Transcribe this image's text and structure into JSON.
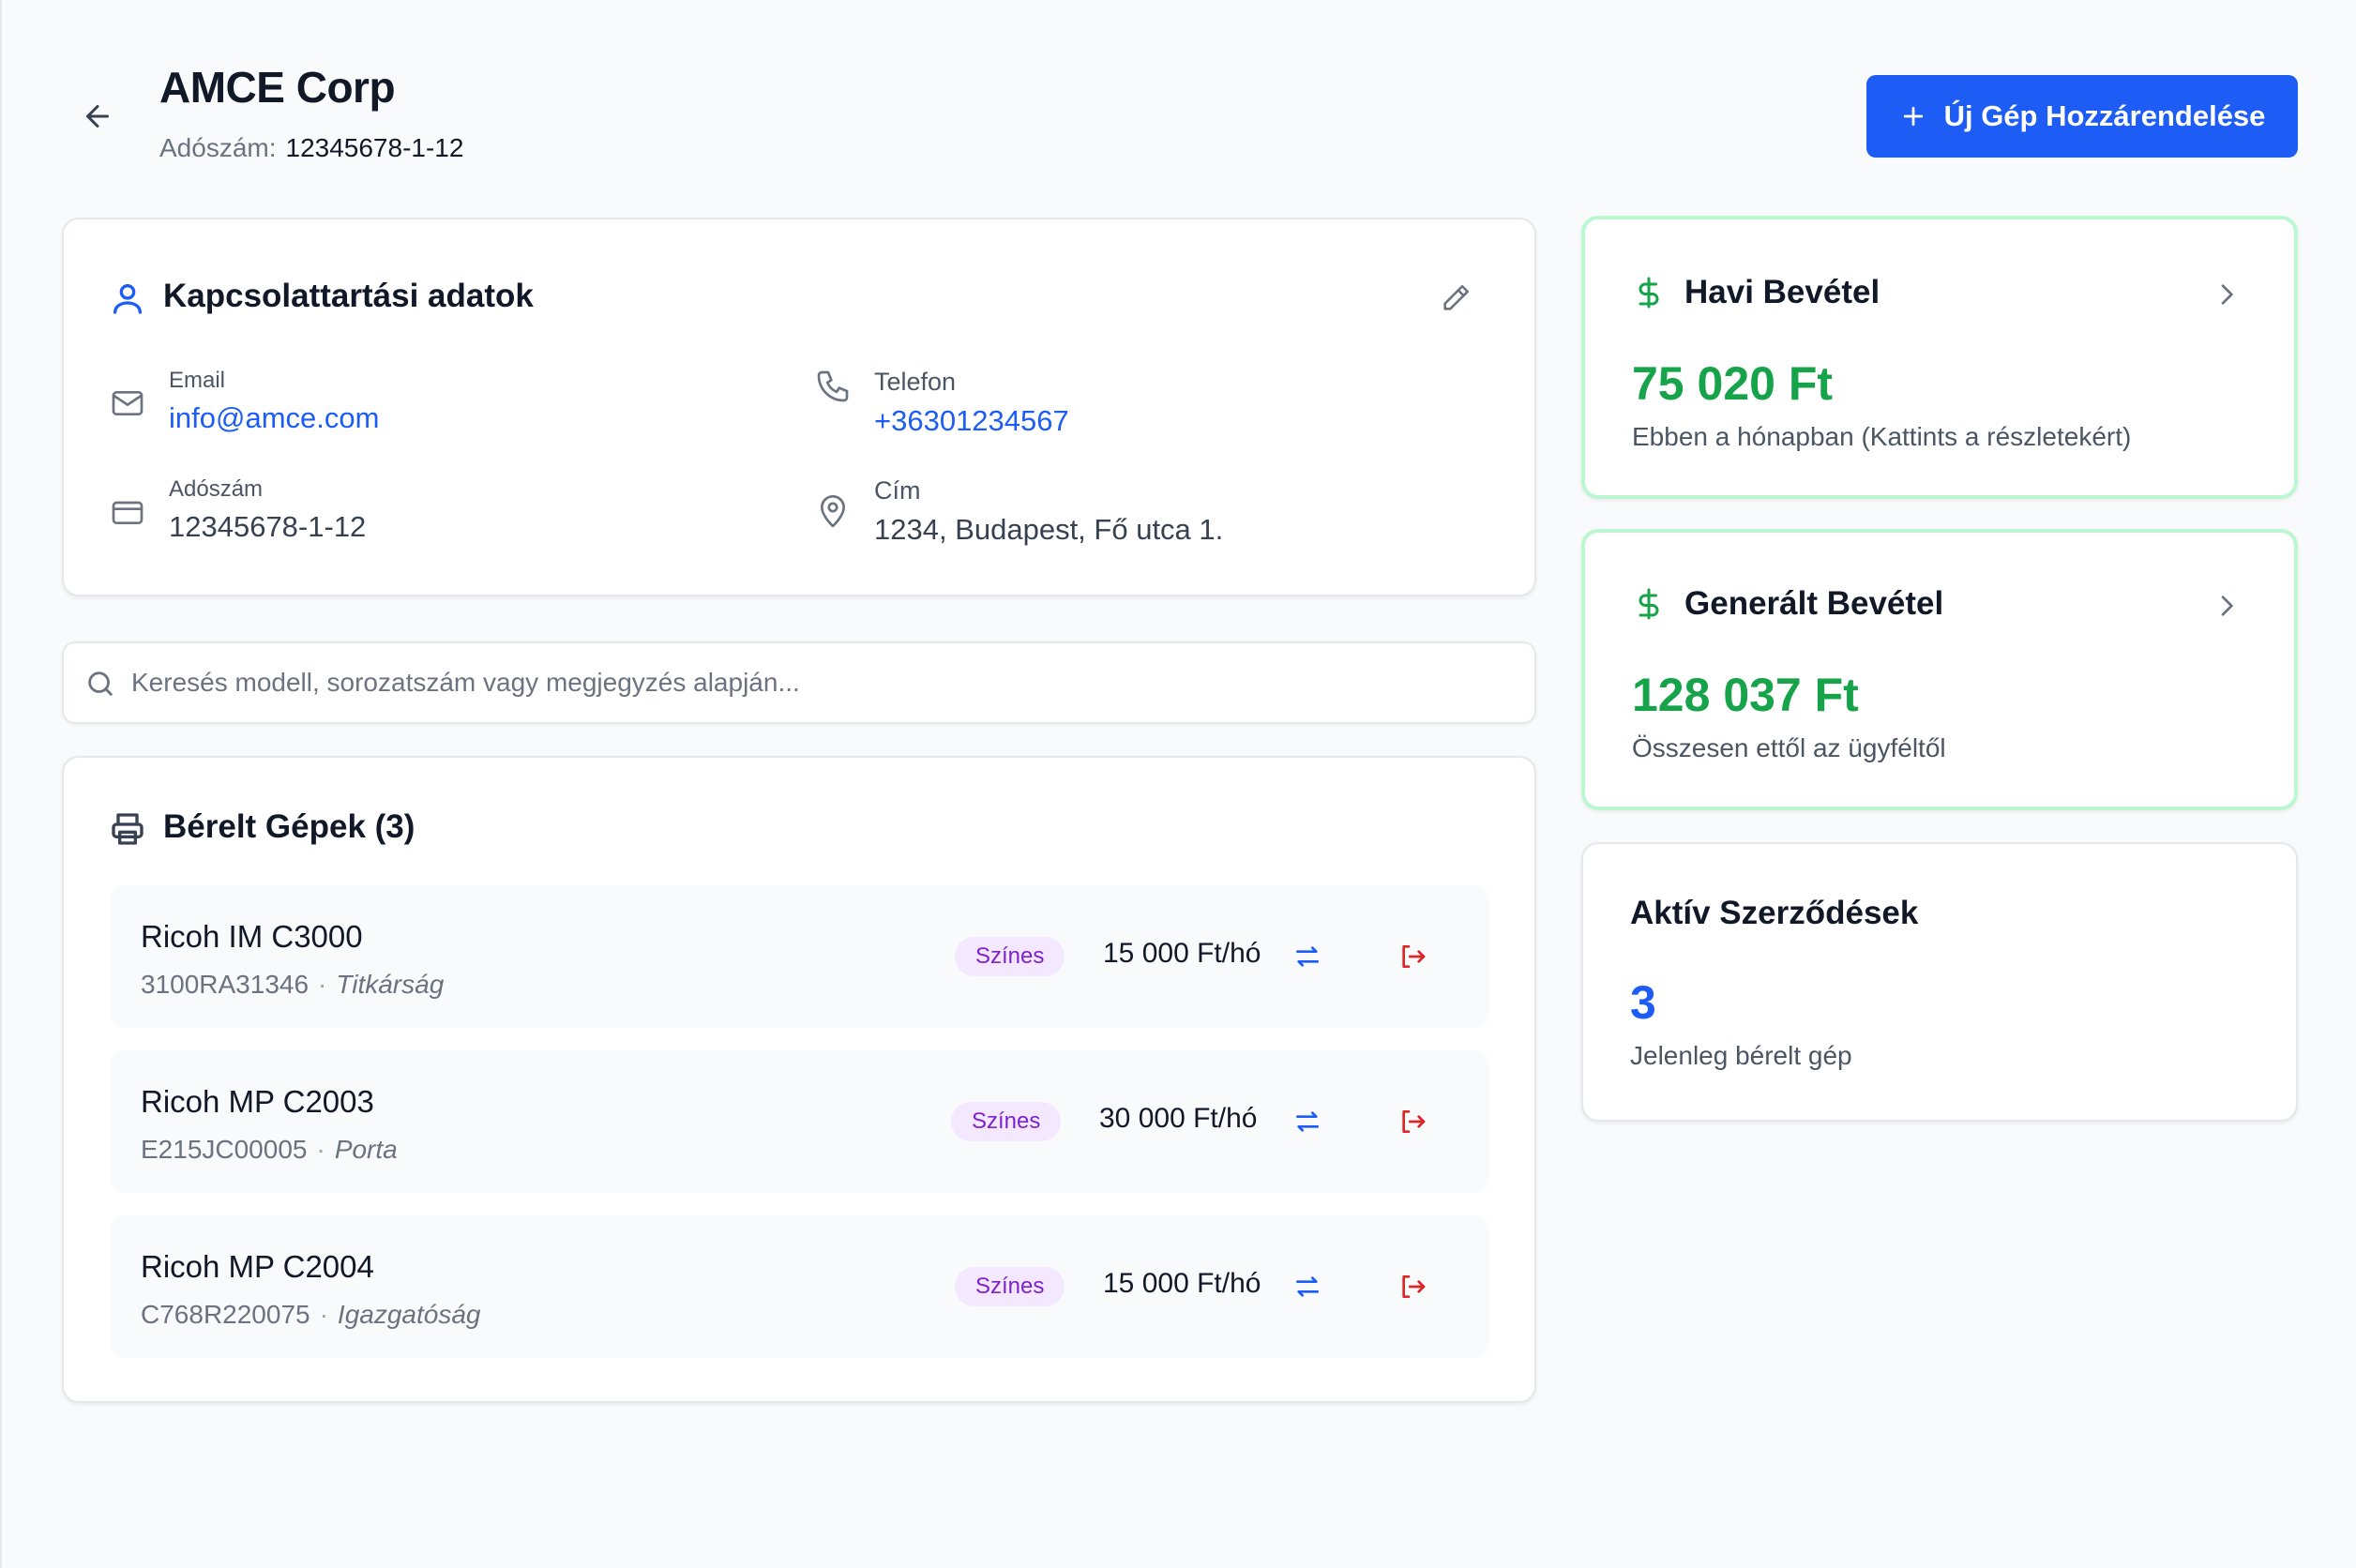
{
  "header": {
    "title": "AMCE Corp",
    "tax_label": "Adószám:",
    "tax_value": "12345678-1-12",
    "new_machine_button": "Új Gép Hozzárendelése"
  },
  "contact": {
    "title": "Kapcsolattartási adatok",
    "email_label": "Email",
    "email_value": "info@amce.com",
    "phone_label": "Telefon",
    "phone_value": "+36301234567",
    "tax_label": "Adószám",
    "tax_value": "12345678-1-12",
    "address_label": "Cím",
    "address_value": "1234, Budapest, Fő utca 1."
  },
  "search": {
    "placeholder": "Keresés modell, sorozatszám vagy megjegyzés alapján..."
  },
  "machines": {
    "title": "Bérelt Gépek (3)",
    "separator": "·",
    "items": [
      {
        "model": "Ricoh IM C3000",
        "serial": "3100RA31346",
        "location": "Titkárság",
        "badge": "Színes",
        "price": "15 000 Ft/hó"
      },
      {
        "model": "Ricoh MP C2003",
        "serial": "E215JC00005",
        "location": "Porta",
        "badge": "Színes",
        "price": "30 000 Ft/hó"
      },
      {
        "model": "Ricoh MP C2004",
        "serial": "C768R220075",
        "location": "Igazgatóság",
        "badge": "Színes",
        "price": "15 000 Ft/hó"
      }
    ]
  },
  "stats": {
    "monthly": {
      "title": "Havi Bevétel",
      "value": "75 020 Ft",
      "desc": "Ebben a hónapban (Kattints a részletekért)"
    },
    "generated": {
      "title": "Generált Bevétel",
      "value": "128 037 Ft",
      "desc": "Összesen ettől az ügyféltől"
    },
    "contracts": {
      "title": "Aktív Szerződések",
      "value": "3",
      "desc": "Jelenleg bérelt gép"
    }
  },
  "colors": {
    "primary": "#1d5cf5",
    "success": "#16a34a",
    "danger": "#dc2626",
    "badge_bg": "#f3e8ff",
    "badge_text": "#7e22ce"
  }
}
